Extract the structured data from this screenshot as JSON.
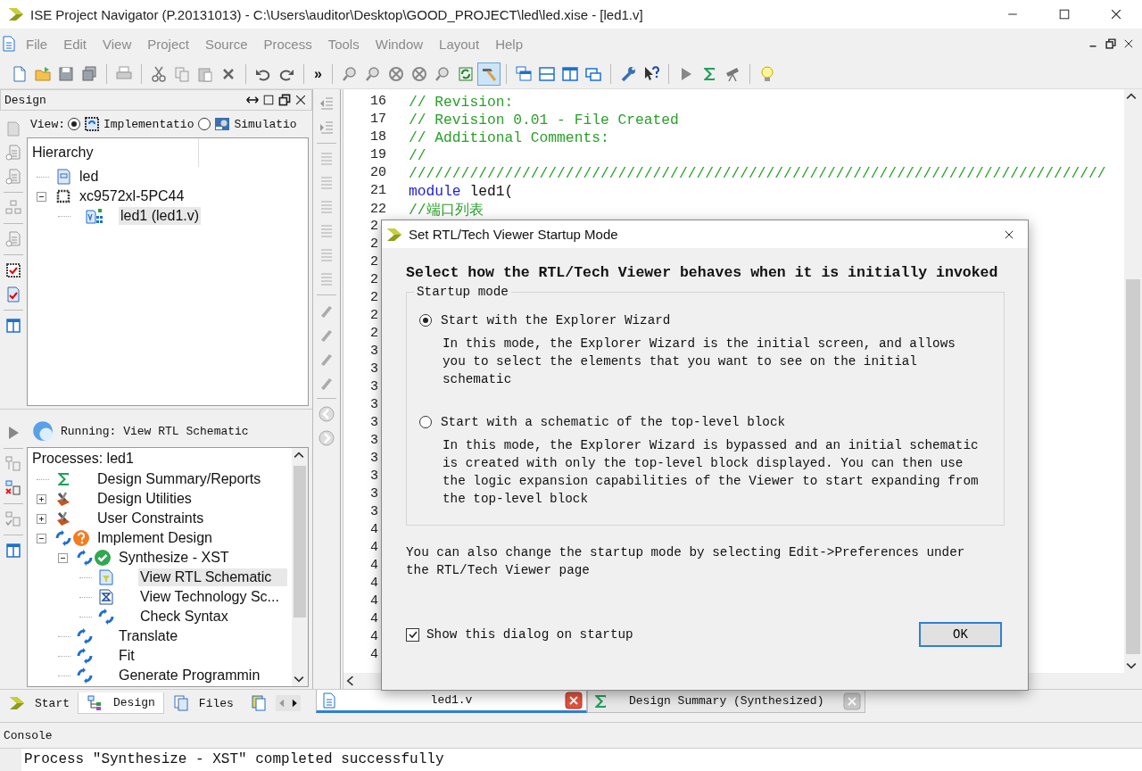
{
  "window": {
    "title": "ISE Project Navigator (P.20131013) - C:\\Users\\auditor\\Desktop\\GOOD_PROJECT\\led\\led.xise - [led1.v]"
  },
  "menu": [
    "File",
    "Edit",
    "View",
    "Project",
    "Source",
    "Process",
    "Tools",
    "Window",
    "Layout",
    "Help"
  ],
  "toolbar": {
    "overflow": "»",
    "hammer_active": true
  },
  "design_panel": {
    "title": "Design",
    "view_label": "View:",
    "view_options": [
      {
        "label": "Implementatio",
        "kind": "implementation",
        "selected": true
      },
      {
        "label": "Simulatio",
        "kind": "simulation",
        "selected": false
      }
    ],
    "hierarchy": {
      "title": "Hierarchy",
      "items": [
        {
          "label": "led",
          "kind": "project",
          "selected": false
        },
        {
          "label": "xc9572xl-5PC44",
          "kind": "device",
          "expanded": true,
          "selected": false,
          "children": [
            {
              "label": "led1 (led1.v)",
              "kind": "module",
              "selected": true
            }
          ]
        }
      ]
    },
    "running": "Running: View RTL Schematic",
    "processes": {
      "title": "Processes: led1",
      "items": [
        {
          "label": "Design Summary/Reports",
          "kind": "report",
          "selected": false
        },
        {
          "label": "Design Utilities",
          "kind": "tools",
          "expanded": false,
          "selected": false
        },
        {
          "label": "User Constraints",
          "kind": "tools",
          "expanded": false,
          "selected": false
        },
        {
          "label": "Implement Design",
          "kind": "process",
          "up_to_date": false,
          "expanded": true,
          "selected": false,
          "children": [
            {
              "label": "Synthesize - XST",
              "kind": "process",
              "up_to_date": true,
              "expanded": true,
              "selected": false,
              "children": [
                {
                  "label": "View RTL Schematic",
                  "kind": "rtl-view",
                  "selected": true
                },
                {
                  "label": "View Technology Sc...",
                  "kind": "tech-view",
                  "selected": false
                },
                {
                  "label": "Check Syntax",
                  "kind": "process",
                  "selected": false
                }
              ]
            },
            {
              "label": "Translate",
              "kind": "process",
              "selected": false
            },
            {
              "label": "Fit",
              "kind": "process",
              "selected": false
            },
            {
              "label": "Generate Programmin",
              "kind": "process",
              "selected": false
            }
          ]
        }
      ]
    }
  },
  "panel_tabs": [
    {
      "label": "Start",
      "kind": "start",
      "selected": false
    },
    {
      "label": "Design",
      "kind": "design",
      "selected": true
    },
    {
      "label": "Files",
      "kind": "files",
      "selected": false
    },
    {
      "kind": "docs",
      "selected": false
    }
  ],
  "editor": {
    "lines": [
      {
        "num": "16",
        "tokens": [
          {
            "text": "// Revision:",
            "kind": "comment"
          }
        ]
      },
      {
        "num": "17",
        "tokens": [
          {
            "text": "// Revision 0.01 - File Created",
            "kind": "comment"
          }
        ]
      },
      {
        "num": "18",
        "tokens": [
          {
            "text": "// Additional Comments:",
            "kind": "comment"
          }
        ]
      },
      {
        "num": "19",
        "tokens": [
          {
            "text": "//",
            "kind": "comment"
          }
        ]
      },
      {
        "num": "20",
        "tokens": [
          {
            "text": "////////////////////////////////////////////////////////////////////////////////",
            "kind": "comment"
          }
        ]
      },
      {
        "num": "21",
        "tokens": [
          {
            "text": "module",
            "kind": "keyword"
          },
          {
            "text": " led1(",
            "kind": "plain"
          }
        ]
      },
      {
        "num": "22",
        "tokens": [
          {
            "text": "//端口列表",
            "kind": "comment"
          }
        ]
      },
      {
        "num": "2"
      },
      {
        "num": "2"
      },
      {
        "num": "2"
      },
      {
        "num": "2"
      },
      {
        "num": "2"
      },
      {
        "num": "2"
      },
      {
        "num": "2"
      },
      {
        "num": "3"
      },
      {
        "num": "3"
      },
      {
        "num": "3"
      },
      {
        "num": "3"
      },
      {
        "num": "3"
      },
      {
        "num": "3"
      },
      {
        "num": "3"
      },
      {
        "num": "3"
      },
      {
        "num": "3"
      },
      {
        "num": "3"
      },
      {
        "num": "4"
      },
      {
        "num": "4"
      },
      {
        "num": "4"
      },
      {
        "num": "4"
      },
      {
        "num": "4"
      },
      {
        "num": "4"
      },
      {
        "num": "4"
      },
      {
        "num": "4"
      }
    ]
  },
  "editor_tabs": [
    {
      "label": "led1.v",
      "kind": "file",
      "selected": true
    },
    {
      "label": "Design Summary (Synthesized)",
      "kind": "summary",
      "selected": false
    }
  ],
  "console": {
    "title": "Console",
    "lines": [
      "Process \"Synthesize - XST\" completed successfully"
    ]
  },
  "dialog": {
    "title": "Set RTL/Tech Viewer Startup Mode",
    "heading": "Select how the RTL/Tech Viewer behaves when it is initially invoked",
    "group": "Startup mode",
    "options": [
      {
        "label": "Start with the Explorer Wizard",
        "description": "In this mode, the Explorer Wizard is the initial screen, and allows you to select the elements that you want to see on the initial schematic",
        "selected": true
      },
      {
        "label": "Start with a schematic of the top-level block",
        "description": "In this mode, the Explorer Wizard is bypassed and an initial schematic is created with only the top-level block displayed. You can then use the logic expansion capabilities of the Viewer to start expanding from the top-level block",
        "selected": false
      }
    ],
    "note": "You can also change the startup mode by selecting Edit->Preferences under the RTL/Tech Viewer page",
    "checkbox": {
      "label": "Show this dialog on startup",
      "checked": true
    },
    "button": "OK"
  }
}
